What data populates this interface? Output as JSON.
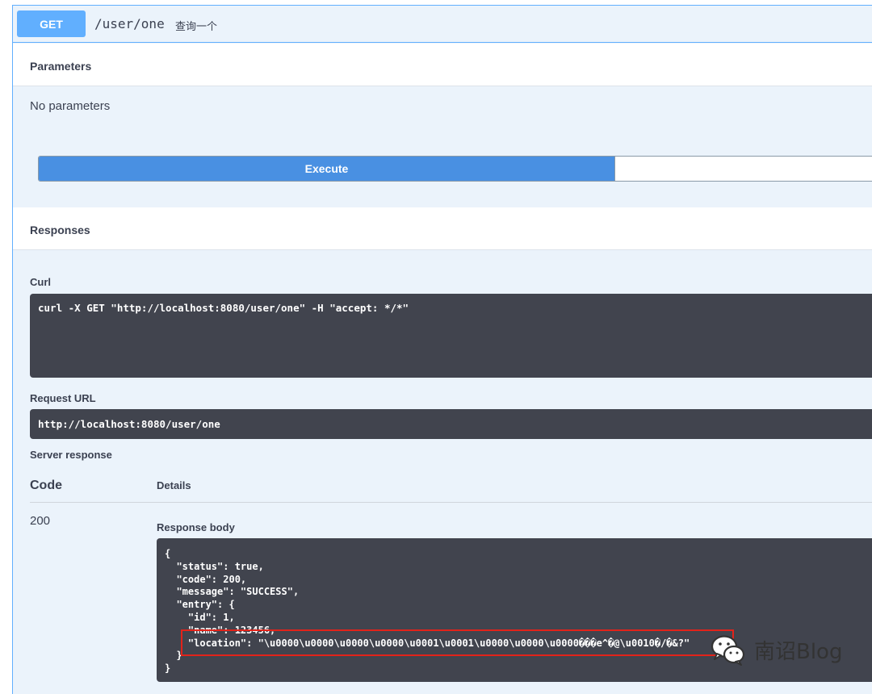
{
  "operation": {
    "method": "GET",
    "path": "/user/one",
    "description": "查询一个"
  },
  "parameters": {
    "title": "Parameters",
    "empty_text": "No parameters"
  },
  "execute": {
    "label": "Execute"
  },
  "responses": {
    "title": "Responses",
    "curl_label": "Curl",
    "curl_command": "curl -X GET \"http://localhost:8080/user/one\" -H \"accept: */*\"",
    "request_url_label": "Request URL",
    "request_url": "http://localhost:8080/user/one",
    "server_response_label": "Server response",
    "col_code": "Code",
    "col_details": "Details",
    "status_code": "200",
    "response_body_label": "Response body",
    "response_body": "{\n  \"status\": true,\n  \"code\": 200,\n  \"message\": \"SUCCESS\",\n  \"entry\": {\n    \"id\": 1,\n    \"name\": 123456,\n    \"location\": \"\\u0000\\u0000\\u0000\\u0000\\u0001\\u0001\\u0000\\u0000\\u0000���e^�@\\u0010�/�&?\"\n  }\n}"
  },
  "watermark": {
    "text": "南诏Blog",
    "icon": "wechat-icon"
  },
  "colors": {
    "get_accent": "#61affe",
    "execute": "#4990e2",
    "code_bg": "#41444e",
    "highlight": "#e2231a"
  }
}
